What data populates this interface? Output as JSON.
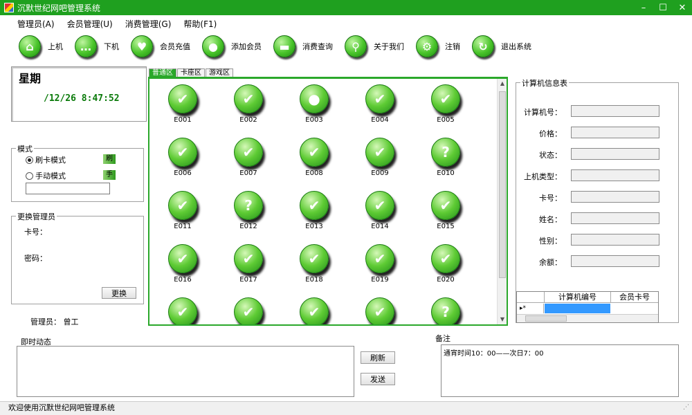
{
  "window": {
    "title": "沉默世纪网吧管理系统",
    "minimize": "–",
    "restore": "☐",
    "close": "✕"
  },
  "menu": [
    "管理员(A)",
    "会员管理(U)",
    "消费管理(G)",
    "帮助(F1)"
  ],
  "toolbar": [
    {
      "label": "上机",
      "icon": "home-icon",
      "glyph": "⌂"
    },
    {
      "label": "下机",
      "icon": "chat-icon",
      "glyph": "…"
    },
    {
      "label": "会员充值",
      "icon": "heart-icon",
      "glyph": "♥"
    },
    {
      "label": "添加会员",
      "icon": "user-icon",
      "glyph": "●"
    },
    {
      "label": "消费查询",
      "icon": "folder-icon",
      "glyph": "▬"
    },
    {
      "label": "关于我们",
      "icon": "search-icon",
      "glyph": "⚲"
    },
    {
      "label": "注销",
      "icon": "gear-icon",
      "glyph": "⚙"
    },
    {
      "label": "退出系统",
      "icon": "refresh-icon",
      "glyph": "↻"
    }
  ],
  "date_panel": {
    "weekday": "星期",
    "datetime": "/12/26 8:47:52"
  },
  "mode": {
    "legend": "模式",
    "options": [
      {
        "label": "刷卡模式",
        "selected": true,
        "tag": "刷"
      },
      {
        "label": "手动模式",
        "selected": false,
        "tag": "手"
      }
    ],
    "input_value": ""
  },
  "admin_change": {
    "legend": "更换管理员",
    "card_label": "卡号：",
    "password_label": "密码：",
    "button": "更换"
  },
  "admin_line": "管理员： 曾工",
  "tabs": [
    "普通区",
    "卡座区",
    "游戏区"
  ],
  "computers": [
    {
      "name": "E001",
      "state": "check"
    },
    {
      "name": "E002",
      "state": "check"
    },
    {
      "name": "E003",
      "state": "user"
    },
    {
      "name": "E004",
      "state": "check"
    },
    {
      "name": "E005",
      "state": "check"
    },
    {
      "name": "E006",
      "state": "check"
    },
    {
      "name": "E007",
      "state": "check"
    },
    {
      "name": "E008",
      "state": "check"
    },
    {
      "name": "E009",
      "state": "check"
    },
    {
      "name": "E010",
      "state": "question"
    },
    {
      "name": "E011",
      "state": "check"
    },
    {
      "name": "E012",
      "state": "question"
    },
    {
      "name": "E013",
      "state": "check"
    },
    {
      "name": "E014",
      "state": "check"
    },
    {
      "name": "E015",
      "state": "check"
    },
    {
      "name": "E016",
      "state": "check"
    },
    {
      "name": "E017",
      "state": "check"
    },
    {
      "name": "E018",
      "state": "check"
    },
    {
      "name": "E019",
      "state": "check"
    },
    {
      "name": "E020",
      "state": "check"
    },
    {
      "name": "",
      "state": "check"
    },
    {
      "name": "",
      "state": "check"
    },
    {
      "name": "",
      "state": "check"
    },
    {
      "name": "",
      "state": "check"
    },
    {
      "name": "",
      "state": "question"
    }
  ],
  "info": {
    "legend": "计算机信息表",
    "fields": [
      "计算机号：",
      "价格：",
      "状态：",
      "上机类型：",
      "卡号：",
      "姓名：",
      "性别：",
      "余额："
    ]
  },
  "grid": {
    "columns": [
      "计算机编号",
      "会员卡号"
    ],
    "row_marker": "▸*"
  },
  "realtime": {
    "label": "即时动态",
    "refresh": "刷新",
    "send": "发送"
  },
  "notes": {
    "label": "备注",
    "text": "通宵时间10：00——次日7：00"
  },
  "status": "欢迎使用沉默世纪网吧管理系统"
}
